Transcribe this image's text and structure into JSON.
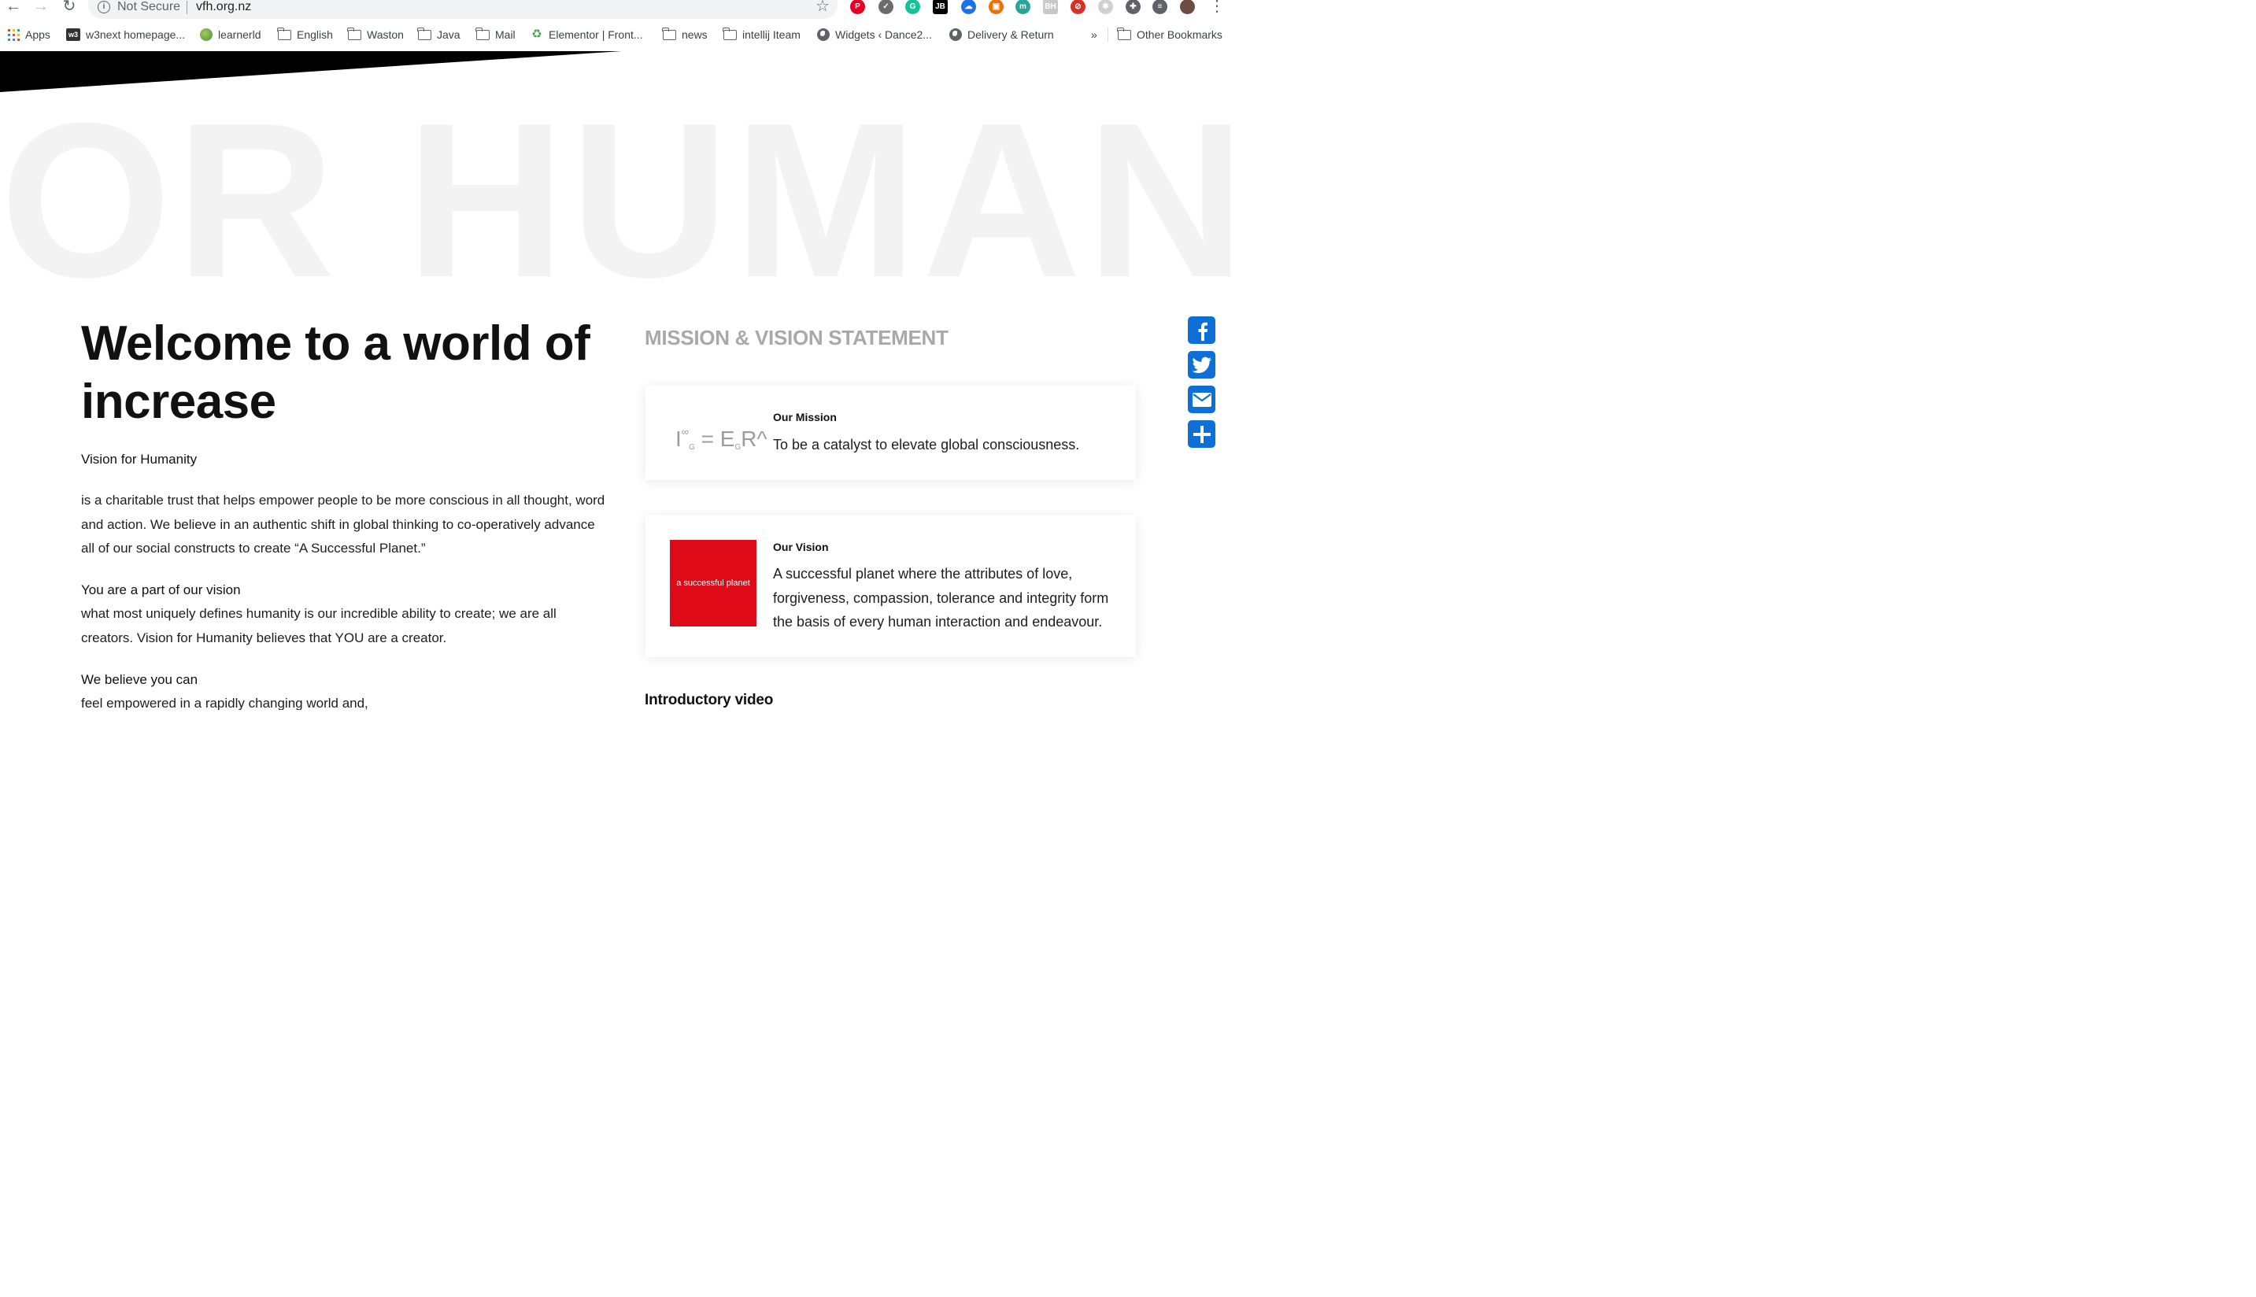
{
  "browser": {
    "security_label": "Not Secure",
    "url": "vfh.org.nz",
    "extensions": [
      {
        "name": "pinterest-icon",
        "label": "P",
        "color": "#e60023"
      },
      {
        "name": "shield-extension-icon",
        "label": "✓",
        "color": "#6b6b6b"
      },
      {
        "name": "grammarly-icon",
        "label": "G",
        "color": "#15c39a"
      },
      {
        "name": "jetbrains-icon",
        "label": "JB",
        "color": "#000000"
      },
      {
        "name": "cloud-extension-icon",
        "label": "☁",
        "color": "#1a73e8"
      },
      {
        "name": "screenshot-extension-icon",
        "label": "▣",
        "color": "#e8710a"
      },
      {
        "name": "m-extension-icon",
        "label": "m",
        "color": "#26a69a"
      },
      {
        "name": "bh-extension-icon",
        "label": "BH",
        "color": "#c8c8c8"
      },
      {
        "name": "block-extension-icon",
        "label": "⊘",
        "color": "#d93025"
      },
      {
        "name": "grey-extension-icon",
        "label": "✱",
        "color": "#d0d0d0"
      },
      {
        "name": "puzzle-extensions-icon",
        "label": "✚",
        "color": "#5f6368"
      },
      {
        "name": "reading-list-icon",
        "label": "≡",
        "color": "#5f6368"
      },
      {
        "name": "profile-avatar-icon",
        "label": "",
        "color": "#6d4c41"
      }
    ]
  },
  "bookmarks": {
    "items": [
      {
        "label": "Apps",
        "icon": "apps-grid-icon"
      },
      {
        "label": "w3next homepage...",
        "icon": "w3-favicon-icon"
      },
      {
        "label": "learnerld",
        "icon": "leaf-favicon-icon"
      },
      {
        "label": "English",
        "icon": "folder-icon"
      },
      {
        "label": "Waston",
        "icon": "folder-icon"
      },
      {
        "label": "Java",
        "icon": "folder-icon"
      },
      {
        "label": "Mail",
        "icon": "folder-icon"
      },
      {
        "label": "Elementor | Front...",
        "icon": "recycle-favicon-icon"
      },
      {
        "label": "news",
        "icon": "folder-icon"
      },
      {
        "label": "intellij Iteam",
        "icon": "folder-icon"
      },
      {
        "label": "Widgets ‹ Dance2...",
        "icon": "globe-icon"
      },
      {
        "label": "Delivery & Return",
        "icon": "globe-icon"
      }
    ],
    "overflow_label": "»",
    "other_label": "Other Bookmarks"
  },
  "hero": {
    "background_word": "OR HUMAN",
    "title": "Welcome to a world of increase",
    "section1_label": "Vision for Humanity",
    "section1_text": "is a charitable trust that helps empower people to be more conscious in all thought, word and action. We believe in an authentic shift in global thinking to co-operatively advance all of our social constructs to create “A Successful Planet.”",
    "section2_label": "You are a part of our vision",
    "section2_text": "what most uniquely defines humanity is our incredible ability to create; we are all creators. Vision for Humanity believes that YOU are a creator.",
    "section3_label": "We believe you can",
    "section3_text": "feel empowered in a rapidly changing world and,"
  },
  "mission_vision": {
    "heading": "MISSION & VISION STATEMENT",
    "mission": {
      "title": "Our Mission",
      "text": "To be a catalyst to elevate global consciousness.",
      "formula": {
        "base": "I",
        "sup": "∞",
        "sub": "G",
        "equals": "= E",
        "sub2": "G",
        "tail": "R^"
      }
    },
    "vision": {
      "title": "Our Vision",
      "text": "A successful planet where the attributes of love, forgiveness, compassion, tolerance and integrity form the basis of every human interaction and endeavour.",
      "image_text": "a successful planet"
    },
    "video_heading": "Introductory video"
  },
  "share": {
    "buttons": [
      "facebook-icon",
      "twitter-icon",
      "email-icon",
      "share-plus-icon"
    ],
    "color": "#0e6fd6"
  }
}
